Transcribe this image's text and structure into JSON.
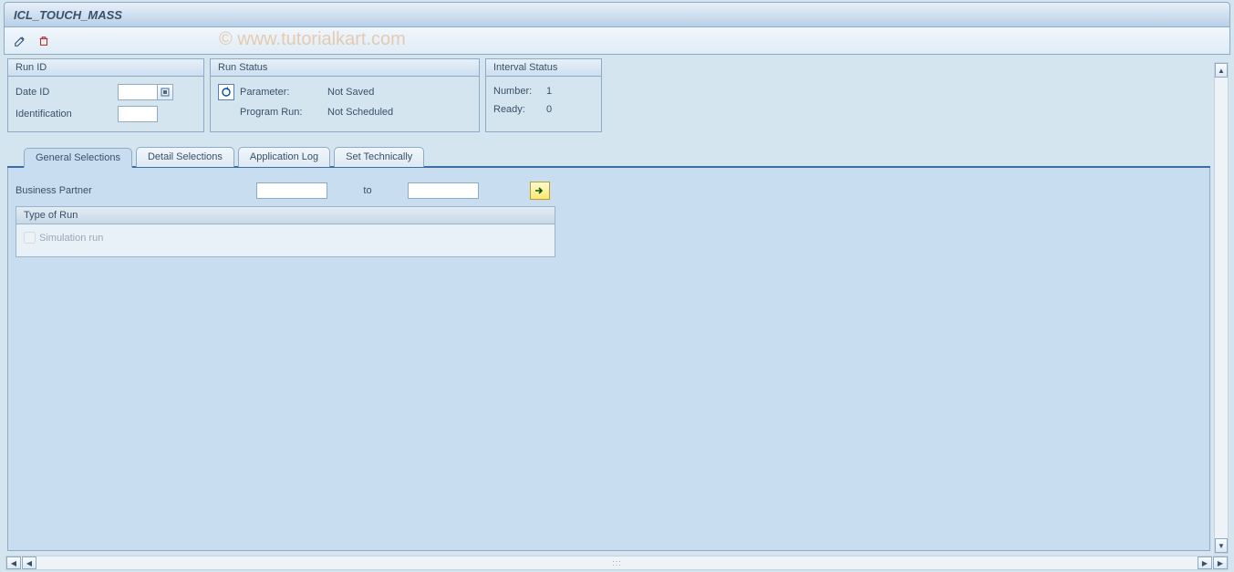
{
  "title": "ICL_TOUCH_MASS",
  "watermark": "© www.tutorialkart.com",
  "run_id": {
    "header": "Run ID",
    "date_id_label": "Date ID",
    "date_id_value": "",
    "identification_label": "Identification",
    "identification_value": ""
  },
  "run_status": {
    "header": "Run Status",
    "parameter_label": "Parameter:",
    "parameter_value": "Not Saved",
    "program_run_label": "Program Run:",
    "program_run_value": "Not Scheduled"
  },
  "interval_status": {
    "header": "Interval Status",
    "number_label": "Number:",
    "number_value": "1",
    "ready_label": "Ready:",
    "ready_value": "0"
  },
  "tabs": [
    {
      "label": "General Selections",
      "active": true
    },
    {
      "label": "Detail Selections",
      "active": false
    },
    {
      "label": "Application Log",
      "active": false
    },
    {
      "label": "Set Technically",
      "active": false
    }
  ],
  "general_selections": {
    "business_partner_label": "Business Partner",
    "business_partner_from": "",
    "to_label": "to",
    "business_partner_to": "",
    "type_of_run_header": "Type of Run",
    "simulation_run_label": "Simulation run",
    "simulation_run_checked": false
  }
}
